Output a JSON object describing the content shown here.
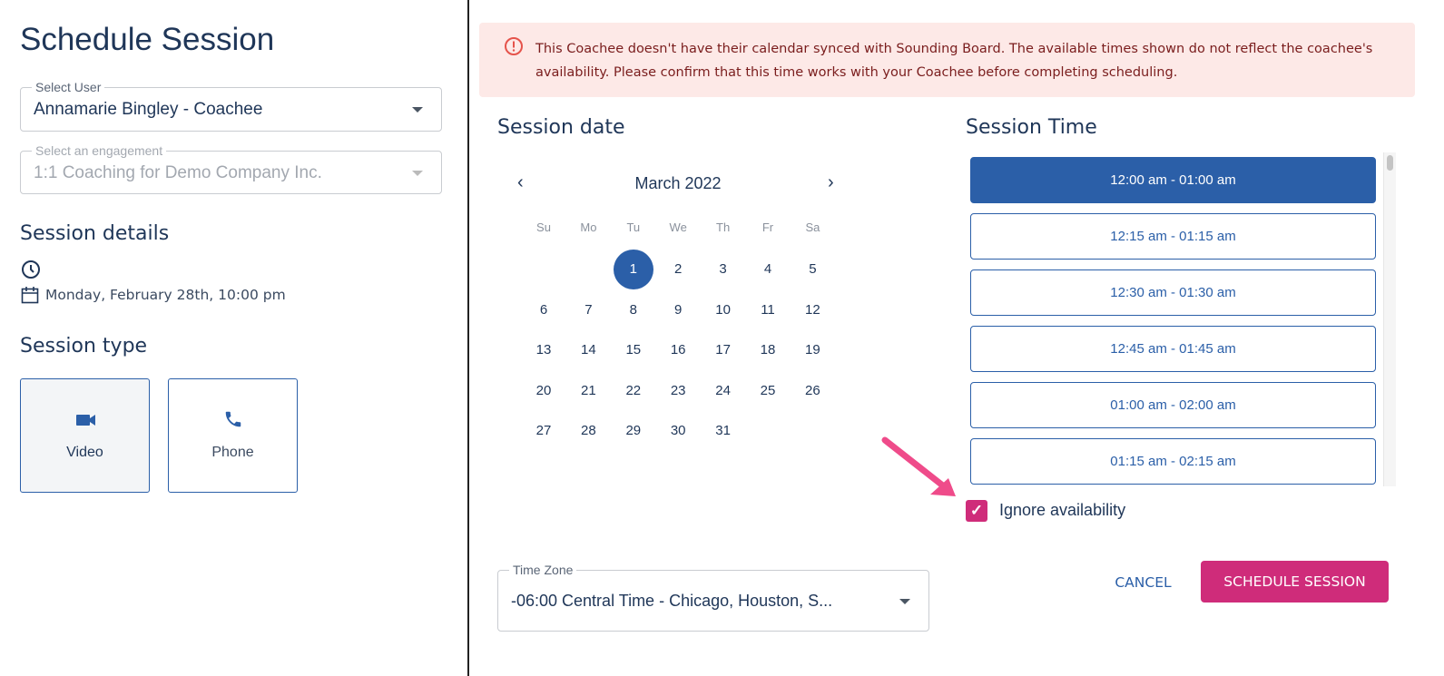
{
  "left": {
    "title": "Schedule Session",
    "select_user": {
      "label": "Select User",
      "value": "Annamarie Bingley  - Coachee"
    },
    "select_engagement": {
      "label": "Select an engagement",
      "value": "1:1 Coaching for Demo Company Inc."
    },
    "session_details": {
      "heading": "Session details",
      "datetime": "Monday, February 28th, 10:00 pm"
    },
    "session_type": {
      "heading": "Session type",
      "options": [
        {
          "label": "Video",
          "icon": "video-camera-icon",
          "selected": true
        },
        {
          "label": "Phone",
          "icon": "phone-icon",
          "selected": false
        }
      ]
    }
  },
  "alert": {
    "icon": "alert-circle-icon",
    "text": "This Coachee doesn't have their calendar synced with Sounding Board. The available times shown do not reflect the coachee's availability. Please confirm that this time works with your Coachee before completing scheduling."
  },
  "calendar": {
    "heading": "Session date",
    "month": "March 2022",
    "weekdays": [
      "Su",
      "Mo",
      "Tu",
      "We",
      "Th",
      "Fr",
      "Sa"
    ],
    "first_weekday_index": 2,
    "days_in_month": 31,
    "selected_day": 1
  },
  "time": {
    "heading": "Session Time",
    "slots": [
      "12:00 am - 01:00 am",
      "12:15 am - 01:15 am",
      "12:30 am - 01:30 am",
      "12:45 am - 01:45 am",
      "01:00 am - 02:00 am",
      "01:15 am - 02:15 am"
    ],
    "selected_index": 0,
    "ignore_availability": {
      "label": "Ignore availability",
      "checked": true
    }
  },
  "timezone": {
    "label": "Time Zone",
    "value": "-06:00 Central Time - Chicago, Houston, S..."
  },
  "actions": {
    "cancel": "CANCEL",
    "schedule": "SCHEDULE SESSION"
  },
  "colors": {
    "primary": "#2b5fa8",
    "accent": "#cf2c7a",
    "alert_bg": "#fde9e7"
  }
}
